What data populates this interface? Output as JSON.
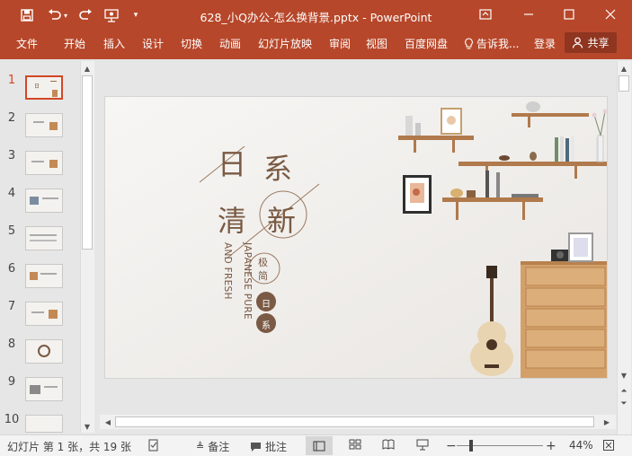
{
  "window": {
    "title": "628_小Q办公-怎么换背景.pptx - PowerPoint"
  },
  "ribbon": {
    "tabs": [
      "文件",
      "开始",
      "插入",
      "设计",
      "切换",
      "动画",
      "幻灯片放映",
      "审阅",
      "视图",
      "百度网盘"
    ],
    "tell_me": "告诉我...",
    "login": "登录",
    "share": "共享"
  },
  "thumbnails": {
    "numbers": [
      "1",
      "2",
      "3",
      "4",
      "5",
      "6",
      "7",
      "8",
      "9",
      "10"
    ],
    "active_index": 1
  },
  "slide": {
    "char_ri": "日",
    "char_xi": "系",
    "char_qing": "清",
    "char_xin": "新",
    "char_ji": "极",
    "char_jian": "简",
    "badge_top": "日",
    "badge_bottom": "系",
    "english_line1": "JAPANESE PURE",
    "english_line2": "AND FRESH"
  },
  "statusbar": {
    "slide_info": "幻灯片 第 1 张，共 19 张",
    "notes": "备注",
    "comments": "批注",
    "zoom": "44%"
  },
  "colors": {
    "ribbon": "#b7472a",
    "accent": "#d24726",
    "slide_text": "#7a5a44"
  }
}
